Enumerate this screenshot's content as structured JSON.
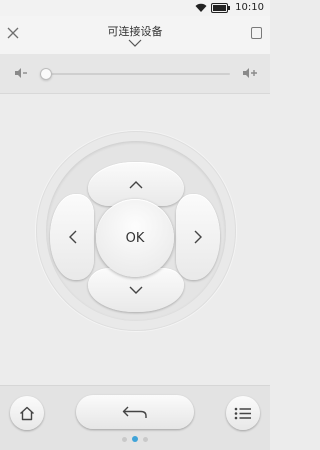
{
  "status_bar": {
    "time": "10:10",
    "icons": [
      "wifi-icon",
      "battery-icon"
    ]
  },
  "header": {
    "title": "可连接设备",
    "left_icon": "close-icon",
    "right_icon": "square-icon"
  },
  "volume": {
    "left_icon": "volume-down-icon",
    "right_icon": "volume-up-icon",
    "level": 0.03
  },
  "dpad": {
    "ok_label": "OK",
    "up_icon": "chevron-up-icon",
    "down_icon": "chevron-down-icon",
    "left_icon": "chevron-left-icon",
    "right_icon": "chevron-right-icon"
  },
  "bottom_bar": {
    "home_icon": "home-icon",
    "back_icon": "back-arrow-icon",
    "menu_icon": "menu-list-icon",
    "page_count": 3,
    "active_page": 2
  },
  "colors": {
    "accent": "#3fa3d8",
    "background": "#ececec"
  }
}
